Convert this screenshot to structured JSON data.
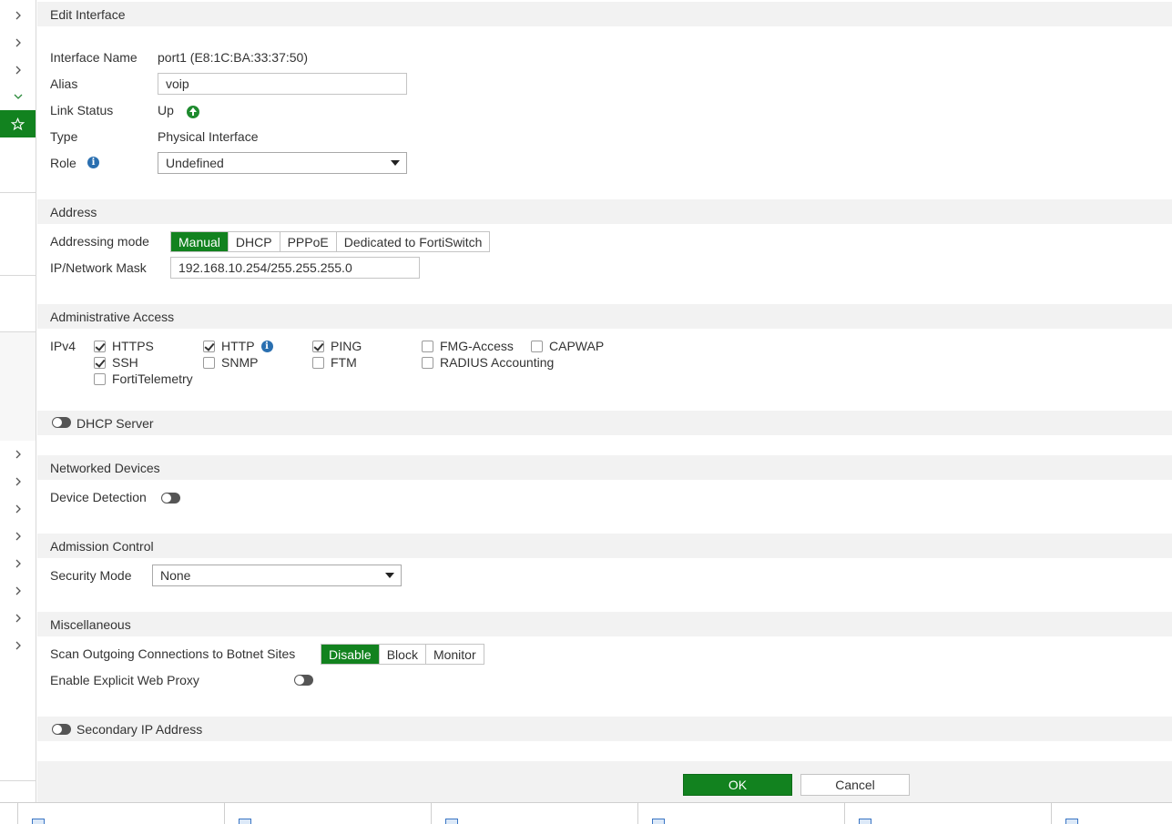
{
  "dialog": {
    "title": "Edit Interface"
  },
  "interface": {
    "name_label": "Interface Name",
    "name_value": "port1 (E8:1C:BA:33:37:50)",
    "alias_label": "Alias",
    "alias_value": "voip",
    "link_label": "Link Status",
    "link_value": "Up",
    "type_label": "Type",
    "type_value": "Physical Interface",
    "role_label": "Role",
    "role_value": "Undefined"
  },
  "address": {
    "header": "Address",
    "mode_label": "Addressing mode",
    "modes": [
      "Manual",
      "DHCP",
      "PPPoE",
      "Dedicated to FortiSwitch"
    ],
    "selected_mode": "Manual",
    "ip_label": "IP/Network Mask",
    "ip_value": "192.168.10.254/255.255.255.0"
  },
  "admin_access": {
    "header": "Administrative Access",
    "ipv4_label": "IPv4",
    "options": [
      {
        "label": "HTTPS",
        "checked": true
      },
      {
        "label": "HTTP",
        "checked": true
      },
      {
        "label": "PING",
        "checked": true
      },
      {
        "label": "FMG-Access",
        "checked": false
      },
      {
        "label": "CAPWAP",
        "checked": false
      },
      {
        "label": "SSH",
        "checked": true
      },
      {
        "label": "SNMP",
        "checked": false
      },
      {
        "label": "FTM",
        "checked": false
      },
      {
        "label": "RADIUS Accounting",
        "checked": false
      },
      {
        "label": "FortiTelemetry",
        "checked": false
      }
    ]
  },
  "dhcp_server": {
    "header": "DHCP Server",
    "enabled": false
  },
  "networked_devices": {
    "header": "Networked Devices",
    "detection_label": "Device Detection",
    "detection_enabled": false
  },
  "admission_control": {
    "header": "Admission Control",
    "security_label": "Security Mode",
    "security_value": "None"
  },
  "misc": {
    "header": "Miscellaneous",
    "botnet_label": "Scan Outgoing Connections to Botnet Sites",
    "botnet_options": [
      "Disable",
      "Block",
      "Monitor"
    ],
    "botnet_selected": "Disable",
    "proxy_label": "Enable Explicit Web Proxy",
    "proxy_enabled": false
  },
  "secondary_ip": {
    "header": "Secondary IP Address",
    "enabled": false
  },
  "footer": {
    "ok_label": "OK",
    "cancel_label": "Cancel"
  },
  "colors": {
    "accent": "#12821f",
    "section_bg": "#f2f2f2",
    "info": "#2a6fb0"
  }
}
